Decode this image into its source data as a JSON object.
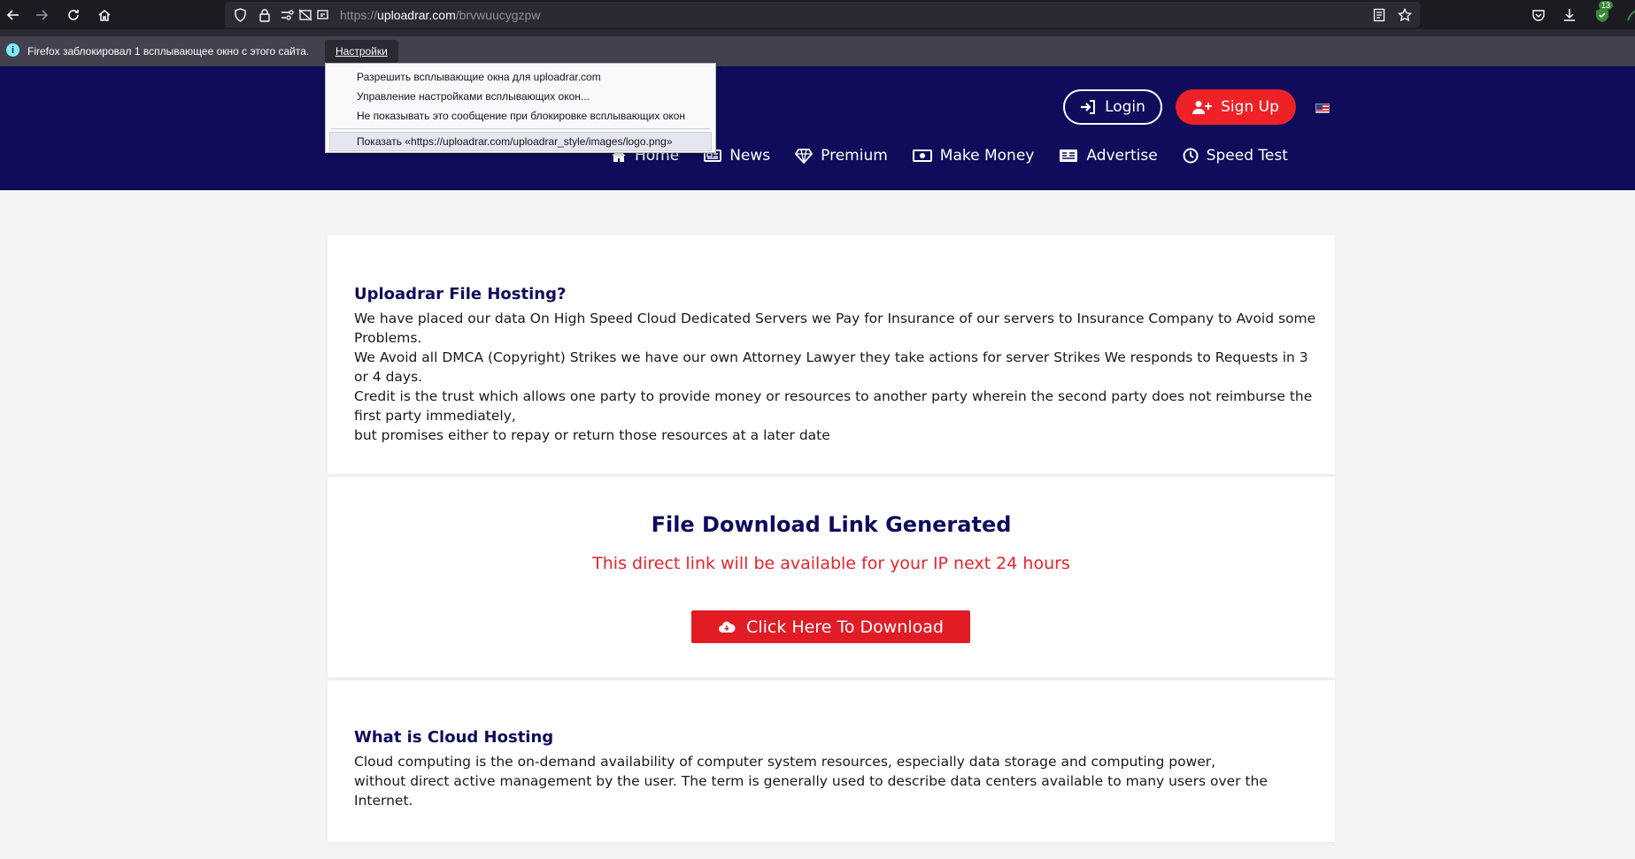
{
  "browser": {
    "url_scheme": "https://",
    "url_host": "uploadrar.com",
    "url_path": "/brvwuucygzpw",
    "extension_badge": "13"
  },
  "notification": {
    "text": "Firefox заблокировал 1 всплывающее окно с этого сайта.",
    "settings_button": "Настройки"
  },
  "popup_menu": {
    "items": [
      "Разрешить всплывающие окна для uploadrar.com",
      "Управление настройками всплывающих окон...",
      "Не показывать это сообщение при блокировке всплывающих окон",
      "Показать «https://uploadrar.com/uploadrar_style/images/logo.png»"
    ]
  },
  "header": {
    "login_label": "Login",
    "signup_label": "Sign Up",
    "nav": [
      "Home",
      "News",
      "Premium",
      "Make Money",
      "Advertise",
      "Speed Test"
    ]
  },
  "section1": {
    "title": "Uploadrar File Hosting?",
    "lines": [
      "We have placed our data On High Speed Cloud Dedicated Servers we Pay for Insurance of our servers to Insurance Company to Avoid some Problems.",
      "We Avoid all DMCA (Copyright) Strikes we have our own Attorney Lawyer they take actions for server Strikes We responds to Requests in 3 or 4 days.",
      "Credit is the trust which allows one party to provide money or resources to another party wherein the second party does not reimburse the first party immediately,",
      "but promises either to repay or return those resources at a later date"
    ]
  },
  "section2": {
    "title": "File Download Link Generated",
    "notice": "This direct link will be available for your IP next 24 hours",
    "button_label": "Click Here To Download"
  },
  "section3": {
    "title": "What is Cloud Hosting",
    "lines": [
      "Cloud computing is the on-demand availability of computer system resources, especially data storage and computing power,",
      "without direct active management by the user. The term is generally used to describe data centers available to many users over the Internet."
    ]
  },
  "colors": {
    "header_bg": "#0f0c5c",
    "accent_red": "#ee2127",
    "title_blue": "#0f0c5c"
  }
}
